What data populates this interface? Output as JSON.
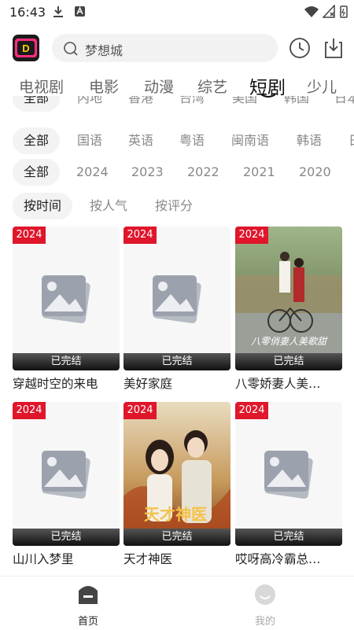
{
  "status_bar": {
    "time": "16:43"
  },
  "search": {
    "placeholder": "梦想城"
  },
  "tabs": [
    {
      "label": "电视剧"
    },
    {
      "label": "电影"
    },
    {
      "label": "动漫"
    },
    {
      "label": "综艺"
    },
    {
      "label": "短剧",
      "active": true
    },
    {
      "label": "少儿"
    }
  ],
  "filters": {
    "region": [
      "全部",
      "内地",
      "香港",
      "台湾",
      "美国",
      "韩国",
      "日本"
    ],
    "language": [
      "全部",
      "国语",
      "英语",
      "粤语",
      "闽南语",
      "韩语",
      "日语"
    ],
    "year": [
      "全部",
      "2024",
      "2023",
      "2022",
      "2021",
      "2020"
    ],
    "sort": [
      "按时间",
      "按人气",
      "按评分"
    ]
  },
  "cards": [
    {
      "year": "2024",
      "status": "已完结",
      "title": "穿越时空的来电"
    },
    {
      "year": "2024",
      "status": "已完结",
      "title": "美好家庭"
    },
    {
      "year": "2024",
      "status": "已完结",
      "title": "八零娇妻人美…",
      "poster_text": "八零俏妻人美歌甜"
    },
    {
      "year": "2024",
      "status": "已完结",
      "title": "山川入梦里"
    },
    {
      "year": "2024",
      "status": "已完结",
      "title": "天才神医",
      "poster_text": "天才神医"
    },
    {
      "year": "2024",
      "status": "已完结",
      "title": "哎呀高冷霸总…"
    }
  ],
  "bottom_nav": [
    {
      "label": "首页",
      "active": true
    },
    {
      "label": "我的"
    }
  ],
  "colors": {
    "badge": "#e0162b",
    "active_tab": "#111111",
    "inactive": "#888888"
  }
}
